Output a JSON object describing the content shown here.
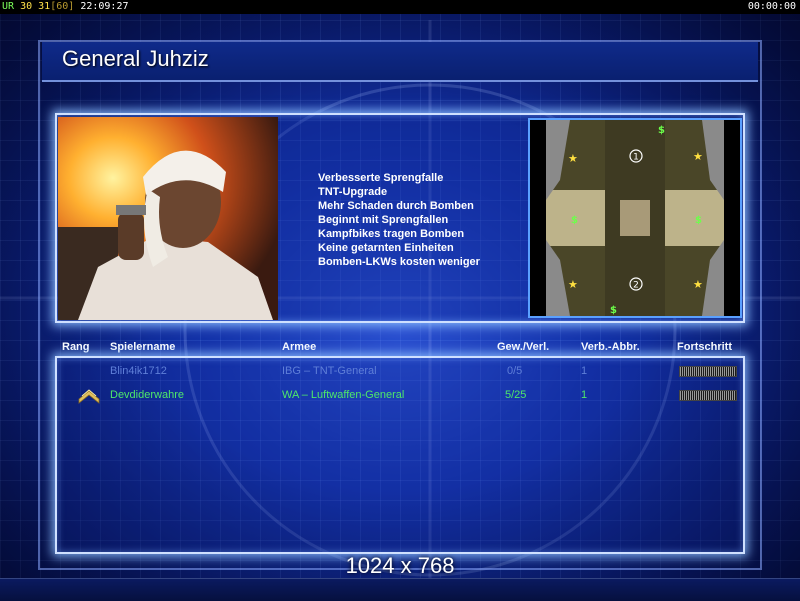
{
  "topbar": {
    "ur": "UR",
    "num1": "30",
    "num2": "31",
    "bracket": "[60]",
    "time_left": "22:09:27",
    "time_right": "00:00:00"
  },
  "general": {
    "title": "General Juhziz",
    "perks": [
      "Verbesserte Sprengfalle",
      "TNT-Upgrade",
      "Mehr Schaden durch Bomben",
      "Beginnt mit Sprengfallen",
      "Kampfbikes tragen Bomben",
      "Keine getarnten Einheiten",
      "Bomben-LKWs kosten weniger"
    ]
  },
  "minimap": {
    "markers": [
      "1",
      "2"
    ]
  },
  "table": {
    "headers": {
      "rank": "Rang",
      "player": "Spielername",
      "army": "Armee",
      "winloss": "Gew./Verl.",
      "disconnects": "Verb.-Abbr.",
      "progress": "Fortschritt"
    },
    "rows": [
      {
        "player": "Blin4ik1712",
        "army": "IBG – TNT-General",
        "winloss": "0/5",
        "disconnects": "1"
      },
      {
        "player": "Devdiderwahre",
        "army": "WA – Luftwaffen-General",
        "winloss": "5/25",
        "disconnects": "1"
      }
    ]
  },
  "footer": {
    "resolution": "1024 x 768"
  },
  "colors": {
    "accent": "#cfe0ff",
    "row_blue": "#5f7fd8",
    "row_green": "#4ee86a"
  }
}
